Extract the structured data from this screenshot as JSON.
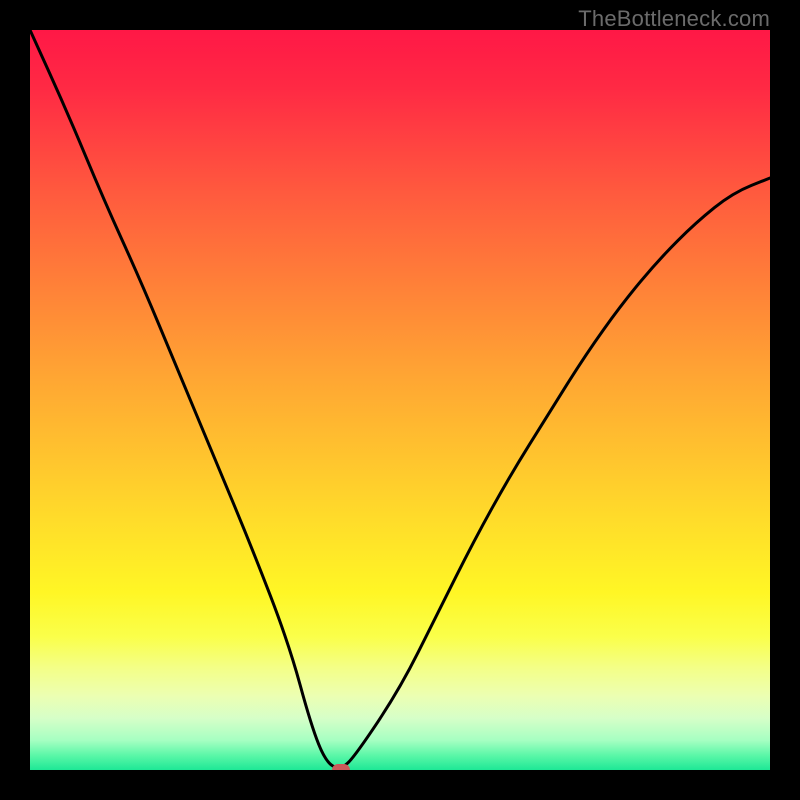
{
  "watermark": "TheBottleneck.com",
  "chart_data": {
    "type": "line",
    "title": "",
    "xlabel": "",
    "ylabel": "",
    "xlim": [
      0,
      100
    ],
    "ylim": [
      0,
      100
    ],
    "series": [
      {
        "name": "bottleneck-curve",
        "x": [
          0,
          5,
          10,
          15,
          20,
          25,
          30,
          35,
          38,
          40,
          42,
          44,
          50,
          55,
          60,
          65,
          70,
          75,
          80,
          85,
          90,
          95,
          100
        ],
        "values": [
          100,
          89,
          77,
          66,
          54,
          42,
          30,
          17,
          6,
          1,
          0,
          2,
          11,
          21,
          31,
          40,
          48,
          56,
          63,
          69,
          74,
          78,
          80
        ]
      }
    ],
    "marker": {
      "x": 42,
      "y": 0
    },
    "gradient_colors": {
      "top": "#ff1846",
      "mid": "#ffe129",
      "bottom": "#1ee896"
    }
  }
}
